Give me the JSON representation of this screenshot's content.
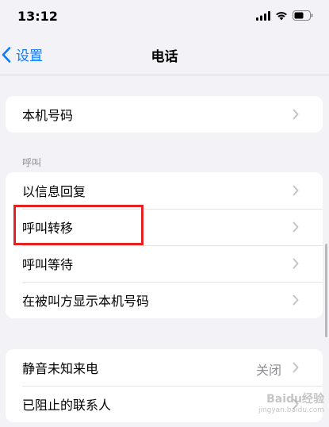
{
  "status_bar": {
    "time": "13:12"
  },
  "nav": {
    "back_label": "设置",
    "title": "电话"
  },
  "group_my_number": {
    "items": [
      {
        "label": "本机号码"
      }
    ]
  },
  "section_calls": {
    "header": "呼叫",
    "items": [
      {
        "label": "以信息回复"
      },
      {
        "label": "呼叫转移"
      },
      {
        "label": "呼叫等待"
      },
      {
        "label": "在被叫方显示本机号码"
      }
    ]
  },
  "group_blocking": {
    "items": [
      {
        "label": "静音未知来电",
        "value": "关闭"
      },
      {
        "label": "已阻止的联系人"
      }
    ]
  },
  "highlight_color": "#e52222",
  "accent_color": "#0a7aff",
  "watermark": {
    "brand": "Baidu经验",
    "url": "jingyan.baidu.com"
  }
}
